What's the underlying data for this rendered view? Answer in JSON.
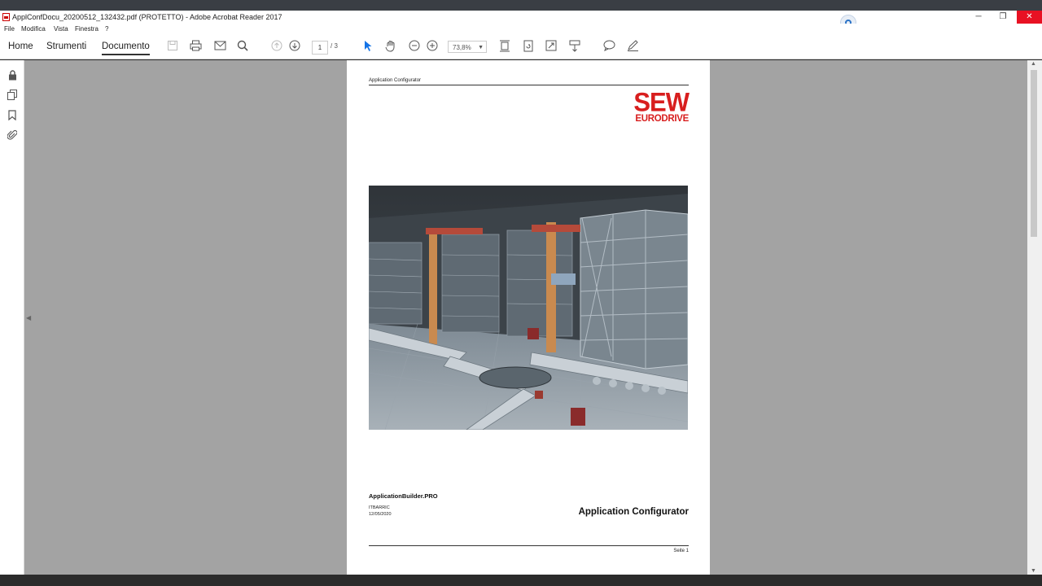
{
  "window": {
    "title": "ApplConfDocu_20200512_132432.pdf (PROTETTO) - Adobe Acrobat Reader 2017",
    "minimize": "─",
    "restore": "❐",
    "close": "✕"
  },
  "menu": [
    "File",
    "Modifica",
    "Vista",
    "Finestra",
    "?"
  ],
  "nav": {
    "home": "Home",
    "tools": "Strumenti",
    "document": "Documento"
  },
  "toolbar": {
    "page_current": "1",
    "page_total": "/ 3",
    "zoom": "73,8%"
  },
  "icons": {
    "save": "save-icon",
    "print": "print-icon",
    "mail": "mail-icon",
    "search": "search-icon",
    "prev": "arrow-up-circle-icon",
    "next": "arrow-down-circle-icon",
    "select": "pointer-icon",
    "hand": "hand-icon",
    "zoom_out": "zoom-out-icon",
    "zoom_in": "zoom-in-icon",
    "fit": "fit-page-icon",
    "rotate": "rotate-icon",
    "fullscreen": "fullscreen-icon",
    "scroll": "scroll-mode-icon",
    "comment": "comment-icon",
    "sign": "pen-icon"
  },
  "sidebar_icons": [
    "lock-icon",
    "pages-icon",
    "bookmark-icon",
    "attachment-icon"
  ],
  "document": {
    "header": "Application Configurator",
    "logo_top": "SEW",
    "logo_bottom": "EURODRIVE",
    "product": "ApplicationBuilder.PRO",
    "author": "ITBARRIC",
    "date": "12/05/2020",
    "title": "Application Configurator",
    "page_label": "Seite 1"
  },
  "colors": {
    "brand_red": "#d81e1e",
    "close_red": "#e81123",
    "accent_blue": "#1473e6",
    "viewer_bg": "#a3a3a3"
  }
}
